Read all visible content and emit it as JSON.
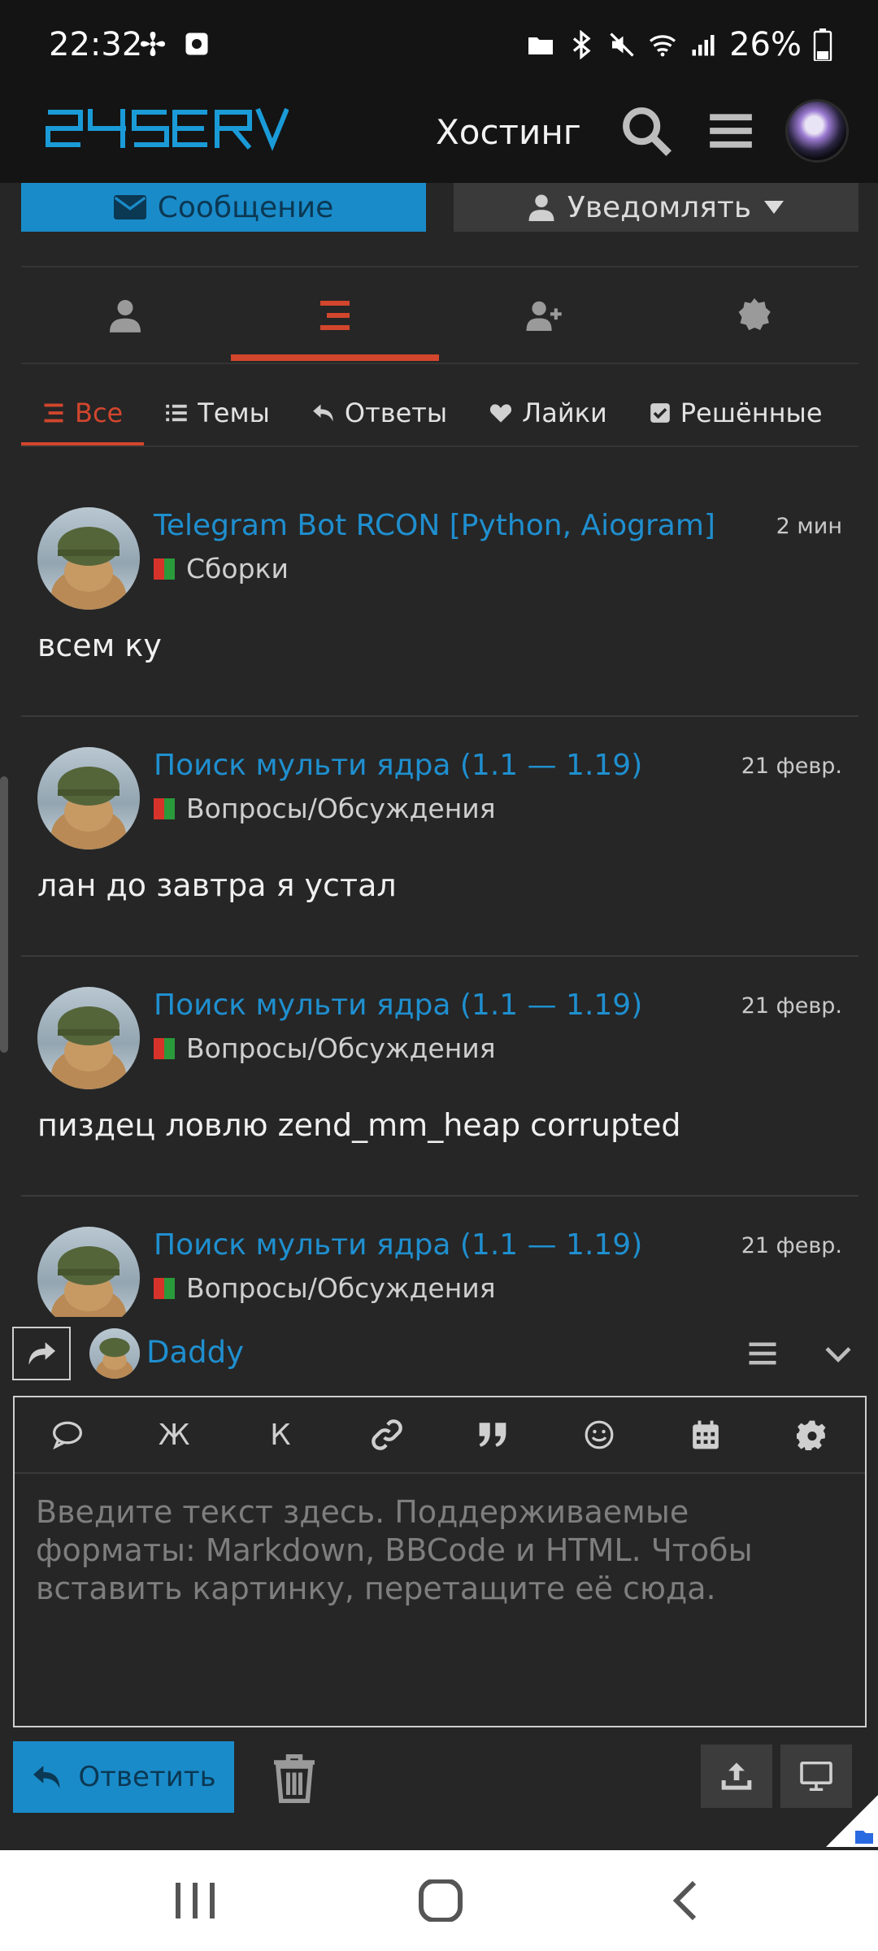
{
  "status_bar": {
    "time": "22:32",
    "battery": "26%",
    "left_icons": [
      "fan-icon",
      "screen-record-icon"
    ],
    "right_icons": [
      "folder-icon",
      "bluetooth-icon",
      "mute-icon",
      "wifi-icon",
      "signal-icon",
      "battery-icon"
    ]
  },
  "header": {
    "logo_text": "24SERV",
    "hosting_label": "Хостинг",
    "icons": [
      "search-icon",
      "menu-icon",
      "avatar"
    ]
  },
  "profile_actions": {
    "message_label": "Сообщение",
    "notify_label": "Уведомлять"
  },
  "profile_tabs": [
    {
      "icon": "user-icon",
      "active": false
    },
    {
      "icon": "list-icon",
      "active": true
    },
    {
      "icon": "user-plus-icon",
      "active": false
    },
    {
      "icon": "badge-icon",
      "active": false
    }
  ],
  "filter_tabs": [
    {
      "label": "Все",
      "icon": "list-icon",
      "active": true
    },
    {
      "label": "Темы",
      "icon": "bullet-list-icon",
      "active": false
    },
    {
      "label": "Ответы",
      "icon": "reply-icon",
      "active": false
    },
    {
      "label": "Лайки",
      "icon": "heart-icon",
      "active": false
    },
    {
      "label": "Решённые",
      "icon": "check-square-icon",
      "active": false
    }
  ],
  "posts": [
    {
      "title": "Telegram Bot RCON [Python, Aiogram]",
      "time": "2 мин",
      "category": "Сборки",
      "body": "всем ку"
    },
    {
      "title": "Поиск мульти ядра (1.1 — 1.19)",
      "time": "21 февр.",
      "category": "Вопросы/Обсуждения",
      "body": "лан до завтра я устал"
    },
    {
      "title": "Поиск мульти ядра (1.1 — 1.19)",
      "time": "21 февр.",
      "category": "Вопросы/Обсуждения",
      "body": "пиздец ловлю zend_mm_heap corrupted"
    },
    {
      "title": "Поиск мульти ядра (1.1 — 1.19)",
      "time": "21 февр.",
      "category": "Вопросы/Обсуждения",
      "body": ""
    }
  ],
  "composer": {
    "reply_to_user": "Daddy",
    "toolbar": {
      "bold_label": "Ж",
      "italic_label": "К"
    },
    "placeholder": "Введите текст здесь. Поддерживаемые форматы: Markdown, BBCode и HTML. Чтобы вставить картинку, перетащите её сюда.",
    "value": "",
    "reply_button_label": "Ответить"
  },
  "colors": {
    "accent_blue": "#1a8bc9",
    "link_blue": "#1f8fcf",
    "accent_orange": "#d2462d",
    "background": "#262626",
    "header_bg": "#141414"
  }
}
